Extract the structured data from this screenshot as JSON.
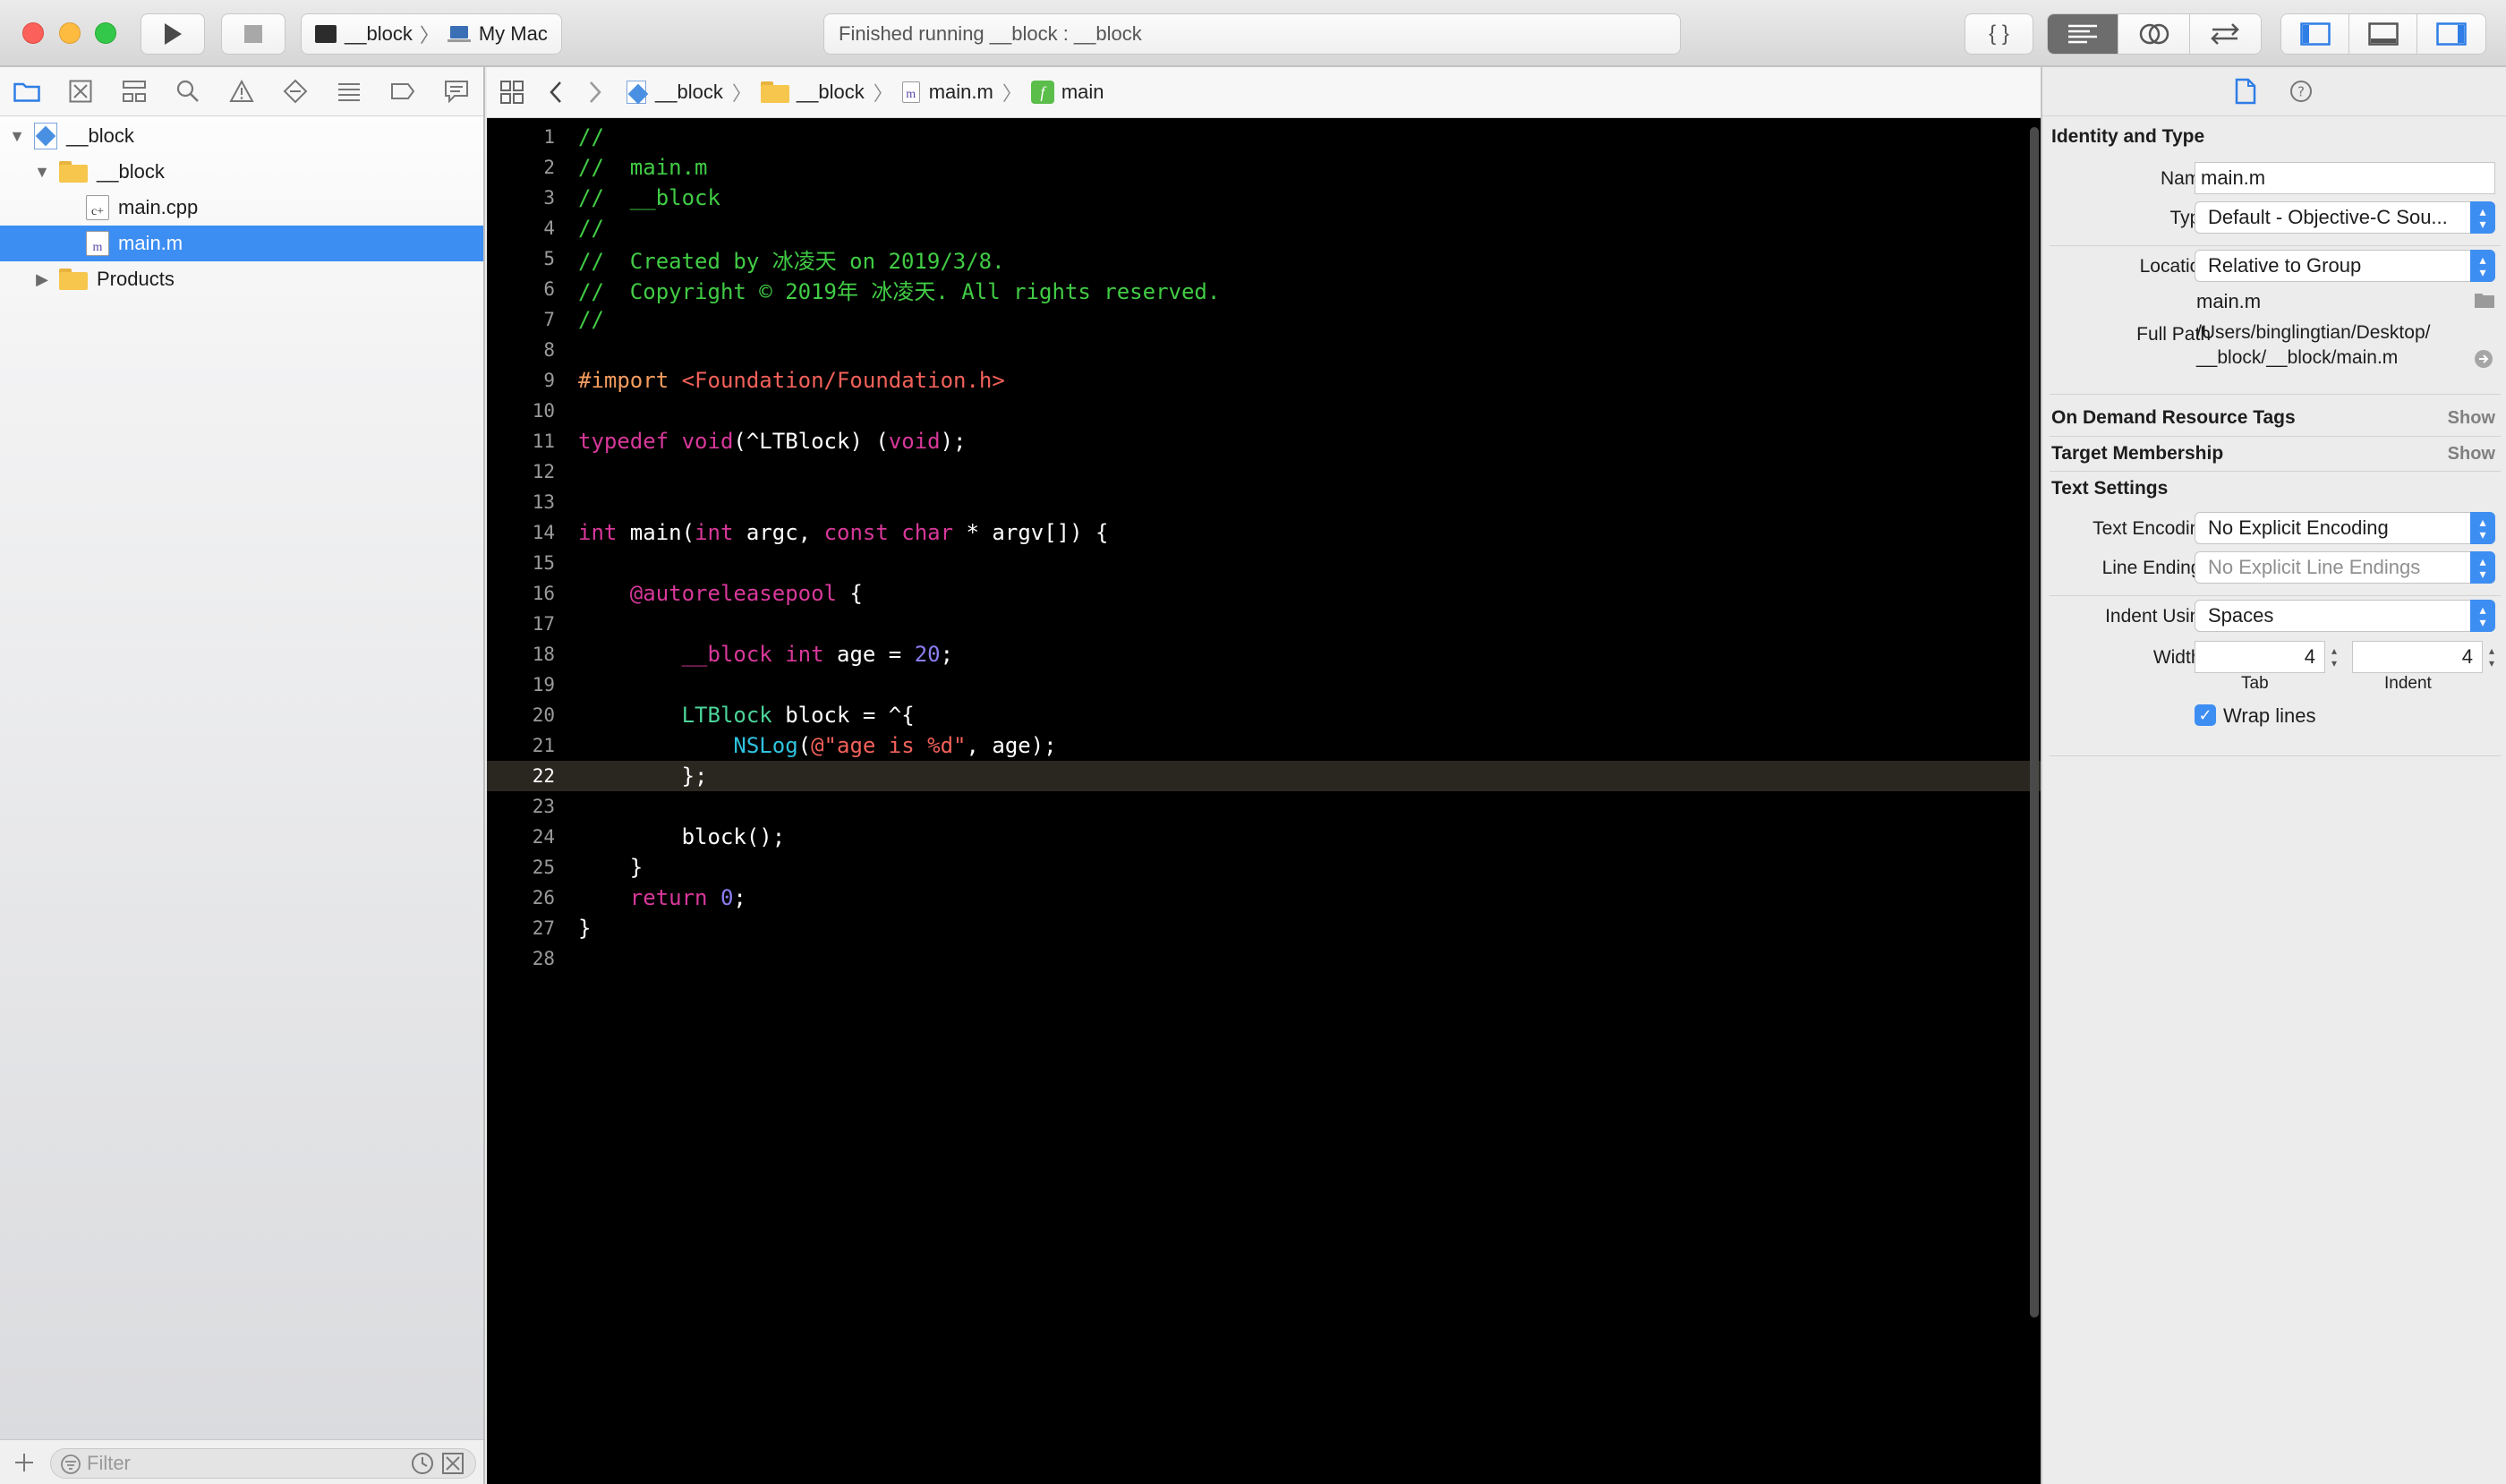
{
  "toolbar": {
    "scheme_target": "__block",
    "scheme_device": "My Mac",
    "activity": "Finished running __block : __block"
  },
  "navigator": {
    "items": [
      {
        "label": "__block",
        "kind": "project"
      },
      {
        "label": "__block",
        "kind": "folder"
      },
      {
        "label": "main.cpp",
        "kind": "file",
        "icon_glyph": "c+"
      },
      {
        "label": "main.m",
        "kind": "file",
        "icon_glyph": "m"
      },
      {
        "label": "Products",
        "kind": "folder"
      }
    ],
    "filter_placeholder": "Filter"
  },
  "jumpbar": {
    "crumbs": [
      "__block",
      "__block",
      "main.m",
      "main"
    ]
  },
  "editor": {
    "current_line": 22,
    "lines": [
      {
        "n": "1",
        "t": [
          [
            "c-comment",
            "//"
          ]
        ]
      },
      {
        "n": "2",
        "t": [
          [
            "c-comment",
            "//  main.m"
          ]
        ]
      },
      {
        "n": "3",
        "t": [
          [
            "c-comment",
            "//  __block"
          ]
        ]
      },
      {
        "n": "4",
        "t": [
          [
            "c-comment",
            "//"
          ]
        ]
      },
      {
        "n": "5",
        "t": [
          [
            "c-comment",
            "//  Created by 冰凌天 on 2019/3/8."
          ]
        ]
      },
      {
        "n": "6",
        "t": [
          [
            "c-comment",
            "//  Copyright © 2019年 冰凌天. All rights reserved."
          ]
        ]
      },
      {
        "n": "7",
        "t": [
          [
            "c-comment",
            "//"
          ]
        ]
      },
      {
        "n": "8",
        "t": []
      },
      {
        "n": "9",
        "t": [
          [
            "c-pre",
            "#import "
          ],
          [
            "c-incl",
            "<Foundation/Foundation.h>"
          ]
        ]
      },
      {
        "n": "10",
        "t": []
      },
      {
        "n": "11",
        "t": [
          [
            "c-kw",
            "typedef"
          ],
          [
            "c-plain",
            " "
          ],
          [
            "c-kw",
            "void"
          ],
          [
            "c-plain",
            "(^LTBlock) ("
          ],
          [
            "c-kw",
            "void"
          ],
          [
            "c-plain",
            ");"
          ]
        ]
      },
      {
        "n": "12",
        "t": []
      },
      {
        "n": "13",
        "t": []
      },
      {
        "n": "14",
        "t": [
          [
            "c-kw",
            "int"
          ],
          [
            "c-plain",
            " main("
          ],
          [
            "c-kw",
            "int"
          ],
          [
            "c-plain",
            " argc, "
          ],
          [
            "c-kw",
            "const"
          ],
          [
            "c-plain",
            " "
          ],
          [
            "c-kw",
            "char"
          ],
          [
            "c-plain",
            " * argv[]) {"
          ]
        ]
      },
      {
        "n": "15",
        "t": []
      },
      {
        "n": "16",
        "t": [
          [
            "c-plain",
            "    "
          ],
          [
            "c-kw",
            "@autoreleasepool"
          ],
          [
            "c-plain",
            " {"
          ]
        ]
      },
      {
        "n": "17",
        "t": []
      },
      {
        "n": "18",
        "t": [
          [
            "c-plain",
            "        "
          ],
          [
            "c-kw",
            "__block"
          ],
          [
            "c-plain",
            " "
          ],
          [
            "c-kw",
            "int"
          ],
          [
            "c-plain",
            " age = "
          ],
          [
            "c-num",
            "20"
          ],
          [
            "c-plain",
            ";"
          ]
        ]
      },
      {
        "n": "19",
        "t": []
      },
      {
        "n": "20",
        "t": [
          [
            "c-plain",
            "        "
          ],
          [
            "c-type",
            "LTBlock"
          ],
          [
            "c-plain",
            " block = ^{"
          ]
        ]
      },
      {
        "n": "21",
        "t": [
          [
            "c-plain",
            "            "
          ],
          [
            "c-func",
            "NSLog"
          ],
          [
            "c-plain",
            "("
          ],
          [
            "c-str",
            "@\"age is %d\""
          ],
          [
            "c-plain",
            ", age);"
          ]
        ]
      },
      {
        "n": "22",
        "t": [
          [
            "c-plain",
            "        };"
          ]
        ]
      },
      {
        "n": "23",
        "t": []
      },
      {
        "n": "24",
        "t": [
          [
            "c-plain",
            "        block();"
          ]
        ]
      },
      {
        "n": "25",
        "t": [
          [
            "c-plain",
            "    }"
          ]
        ]
      },
      {
        "n": "26",
        "t": [
          [
            "c-plain",
            "    "
          ],
          [
            "c-kw",
            "return"
          ],
          [
            "c-plain",
            " "
          ],
          [
            "c-num",
            "0"
          ],
          [
            "c-plain",
            ";"
          ]
        ]
      },
      {
        "n": "27",
        "t": [
          [
            "c-plain",
            "}"
          ]
        ]
      },
      {
        "n": "28",
        "t": []
      }
    ]
  },
  "inspector": {
    "identity_title": "Identity and Type",
    "name_label": "Name",
    "name_value": "main.m",
    "type_label": "Type",
    "type_value": "Default - Objective-C Sou...",
    "location_label": "Location",
    "location_value": "Relative to Group",
    "location_file": "main.m",
    "fullpath_label": "Full Path",
    "fullpath_line1": "/Users/binglingtian/Desktop/",
    "fullpath_line2": "__block/__block/main.m",
    "odr_title": "On Demand Resource Tags",
    "odr_show": "Show",
    "target_title": "Target Membership",
    "target_show": "Show",
    "text_settings_title": "Text Settings",
    "encoding_label": "Text Encoding",
    "encoding_value": "No Explicit Encoding",
    "line_endings_label": "Line Endings",
    "line_endings_value": "No Explicit Line Endings",
    "indent_using_label": "Indent Using",
    "indent_using_value": "Spaces",
    "widths_label": "Widths",
    "tab_width": "4",
    "indent_width": "4",
    "tab_caption": "Tab",
    "indent_caption": "Indent",
    "wrap_label": "Wrap lines",
    "wrap_checked": true
  },
  "colors": {
    "accent": "#3d8ef2",
    "editor_bg": "#000000",
    "comment": "#41cc45",
    "keyword": "#d8389a"
  }
}
